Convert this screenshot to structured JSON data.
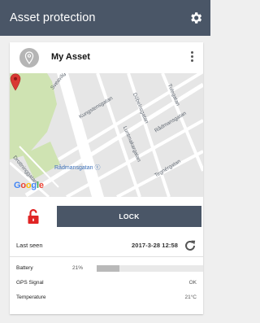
{
  "app_bar": {
    "title": "Asset protection",
    "settings_icon": "gear-icon"
  },
  "asset": {
    "name": "My Asset",
    "avatar_icon": "location-pin-icon",
    "menu_icon": "more-vert-icon"
  },
  "map": {
    "streets": [
      "Sveavägen",
      "Kungstensgatan",
      "Döbelnsgatan",
      "Tulegatan",
      "Rådmansgatan",
      "Luntmakargatan",
      "Tegnérgatan",
      "Drottninggatan"
    ],
    "poi_label": "Rådmansgatan",
    "logo": "Google",
    "marker_color": "#d93a33"
  },
  "lock": {
    "button_label": "LOCK",
    "icon": "unlocked-padlock-icon",
    "icon_color": "#e02424"
  },
  "last_seen": {
    "label": "Last seen",
    "timestamp": "2017-3-28 12:58",
    "refresh_icon": "refresh-icon"
  },
  "battery": {
    "label": "Battery",
    "value": "21%",
    "level": 0.21
  },
  "gps": {
    "label": "GPS Signal",
    "value": "OK"
  },
  "temperature": {
    "label": "Temperature",
    "value": "21°C"
  },
  "colors": {
    "app_bar": "#4a5667",
    "background": "#efefef",
    "card": "#ffffff"
  }
}
